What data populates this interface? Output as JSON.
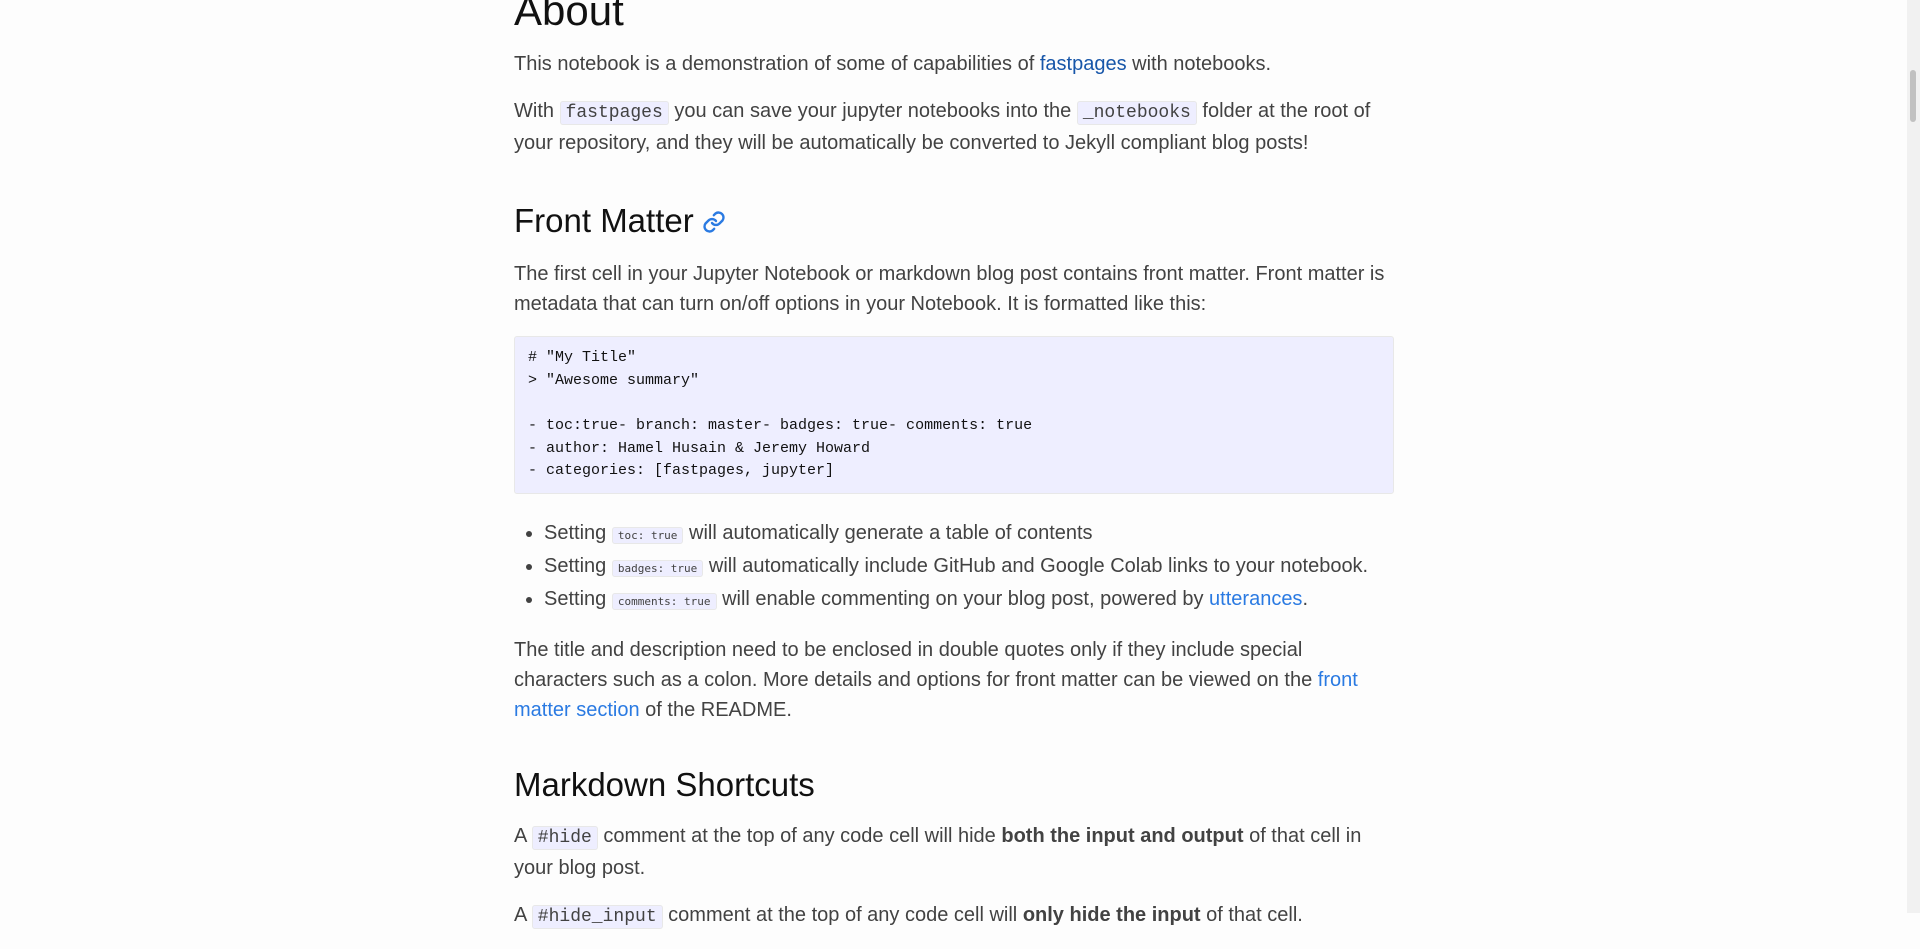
{
  "about": {
    "heading": "About",
    "intro": {
      "before": "This notebook is a demonstration of some of capabilities of ",
      "link": "fastpages",
      "after": " with notebooks."
    },
    "with_para": {
      "t1": "With ",
      "code1": "fastpages",
      "t2": " you can save your jupyter notebooks into the ",
      "code2": "_notebooks",
      "t3": " folder at the root of your repository, and they will be automatically be converted to Jekyll compliant blog posts!"
    }
  },
  "front_matter": {
    "heading": "Front Matter",
    "anchor_icon": "link-icon",
    "intro": "The first cell in your Jupyter Notebook or markdown blog post contains front matter. Front matter is metadata that can turn on/off options in your Notebook. It is formatted like this:",
    "code_lines": [
      "# \"My Title\"",
      "> \"Awesome summary\"",
      "",
      "- toc:true- branch: master- badges: true- comments: true",
      "- author: Hamel Husain & Jeremy Howard",
      "- categories: [fastpages, jupyter]"
    ],
    "bullets": [
      {
        "prefix": "Setting ",
        "code": "toc: true",
        "suffix": " will automatically generate a table of contents",
        "link": "",
        "end": ""
      },
      {
        "prefix": "Setting ",
        "code": "badges: true",
        "suffix": " will automatically include GitHub and Google Colab links to your notebook.",
        "link": "",
        "end": ""
      },
      {
        "prefix": "Setting ",
        "code": "comments: true",
        "suffix": " will enable commenting on your blog post, powered by ",
        "link": "utterances",
        "end": "."
      }
    ],
    "quotes_para": {
      "before": "The title and description need to be enclosed in double quotes only if they include special characters such as a colon. More details and options for front matter can be viewed on the ",
      "link": "front matter section",
      "after": " of the README."
    }
  },
  "markdown_shortcuts": {
    "heading": "Markdown Shortcuts",
    "hide_para": {
      "t1": "A ",
      "code": "#hide",
      "t2": " comment at the top of any code cell will hide ",
      "bold": "both the input and output",
      "t3": " of that cell in your blog post."
    },
    "hide_input_para": {
      "t1": "A ",
      "code": "#hide_input",
      "t2": " comment at the top of any code cell will ",
      "bold": "only hide the input",
      "t3": " of that cell."
    }
  },
  "colors": {
    "link": "#2a7ae2",
    "visited_link": "#1756a9",
    "code_background": "#eeeeff",
    "text": "#424242"
  }
}
